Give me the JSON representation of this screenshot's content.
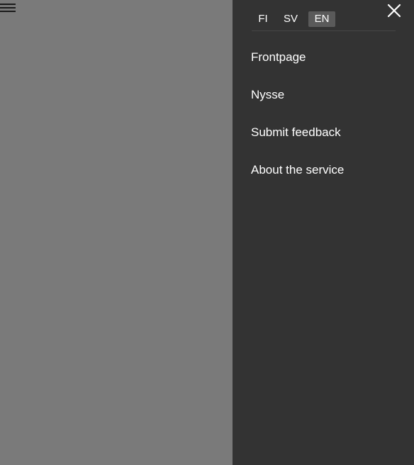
{
  "languages": [
    {
      "code": "FI",
      "active": false
    },
    {
      "code": "SV",
      "active": false
    },
    {
      "code": "EN",
      "active": true
    }
  ],
  "menu": {
    "items": [
      {
        "label": "Frontpage"
      },
      {
        "label": "Nysse"
      },
      {
        "label": "Submit feedback"
      },
      {
        "label": "About the service"
      }
    ]
  },
  "icons": {
    "open_menu": "hamburger-icon",
    "close_menu": "close-icon"
  },
  "colors": {
    "drawer_background": "#333333",
    "overlay_background": "#7a7a7a",
    "active_language_background": "#5a5a5a",
    "text": "#ffffff"
  }
}
